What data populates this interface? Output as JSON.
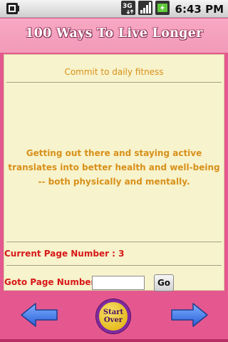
{
  "status_bar": {
    "network_label": "3G",
    "time": "6:43 PM"
  },
  "header": {
    "title": "100 Ways To Live Longer"
  },
  "content": {
    "topic": "Commit to daily fitness",
    "body": "Getting out there and staying active translates into better health and well-being -- both physically and mentally.",
    "current_page_text": "Current Page Number : 3",
    "goto_label": "Goto Page Number :",
    "goto_value": "",
    "go_button": "Go"
  },
  "nav": {
    "start_over_label": "Start Over",
    "prev_icon": "left-arrow-icon",
    "next_icon": "right-arrow-icon"
  },
  "colors": {
    "background": "#e5588f",
    "header": "#f29ab9",
    "panel": "#f7f3cc",
    "topic_text": "#d8901a",
    "page_text": "#d81818"
  }
}
